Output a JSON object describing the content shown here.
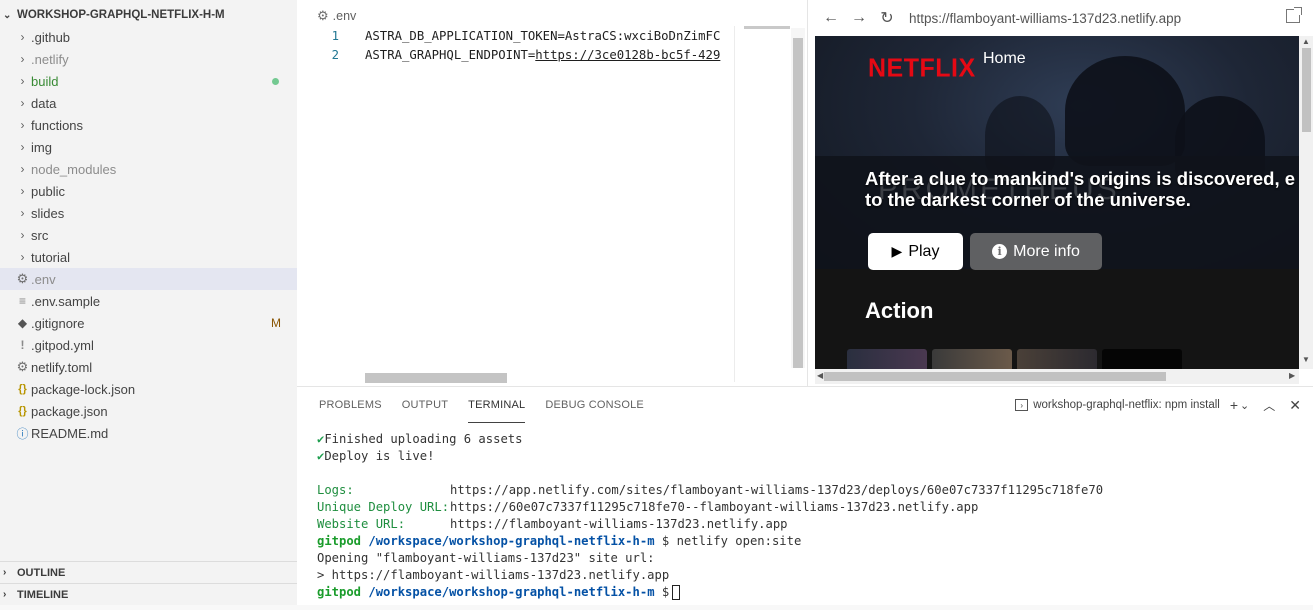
{
  "explorer": {
    "title": "WORKSHOP-GRAPHQL-NETFLIX-H-M",
    "items": [
      {
        "label": ".github",
        "kind": "folder"
      },
      {
        "label": ".netlify",
        "kind": "folder"
      },
      {
        "label": "build",
        "kind": "folder"
      },
      {
        "label": "data",
        "kind": "folder"
      },
      {
        "label": "functions",
        "kind": "folder"
      },
      {
        "label": "img",
        "kind": "folder"
      },
      {
        "label": "node_modules",
        "kind": "folder"
      },
      {
        "label": "public",
        "kind": "folder"
      },
      {
        "label": "slides",
        "kind": "folder"
      },
      {
        "label": "src",
        "kind": "folder"
      },
      {
        "label": "tutorial",
        "kind": "folder"
      },
      {
        "label": ".env",
        "kind": "file"
      },
      {
        "label": ".env.sample",
        "kind": "file"
      },
      {
        "label": ".gitignore",
        "kind": "file",
        "badge": "M"
      },
      {
        "label": ".gitpod.yml",
        "kind": "file"
      },
      {
        "label": "netlify.toml",
        "kind": "file"
      },
      {
        "label": "package-lock.json",
        "kind": "file"
      },
      {
        "label": "package.json",
        "kind": "file"
      },
      {
        "label": "README.md",
        "kind": "file"
      }
    ],
    "outline_label": "OUTLINE",
    "timeline_label": "TIMELINE"
  },
  "editor": {
    "tab_label": ".env",
    "lines": [
      {
        "num": "1",
        "prefix": "ASTRA_DB_APPLICATION_TOKEN=AstraCS:wxciBoDnZimFC",
        "url": ""
      },
      {
        "num": "2",
        "prefix": "ASTRA_GRAPHQL_ENDPOINT=",
        "url": "https://3ce0128b-bc5f-429"
      }
    ]
  },
  "browser": {
    "url": "https://flamboyant-williams-137d23.netlify.app",
    "logo": "NETFLIX",
    "nav_home": "Home",
    "ghost_title": "PROMETHEUS",
    "hero_line1": "After a clue to mankind's origins is discovered, e",
    "hero_line2": "to the darkest corner of the universe.",
    "play_label": "Play",
    "more_label": "More info",
    "row_title": "Action",
    "colors": {
      "logo": "#e50914",
      "background": "#141414"
    }
  },
  "panel": {
    "tabs": [
      "PROBLEMS",
      "OUTPUT",
      "TERMINAL",
      "DEBUG CONSOLE"
    ],
    "active_tab": "TERMINAL",
    "terminal_name": "workshop-graphql-netflix: npm install",
    "lines": {
      "l1": "Finished uploading 6 assets",
      "l2": "Deploy is live!",
      "logs_key": "Logs:",
      "logs_val": "https://app.netlify.com/sites/flamboyant-williams-137d23/deploys/60e07c7337f11295c718fe70",
      "unique_key": "Unique Deploy URL:",
      "unique_val": "https://60e07c7337f11295c718fe70--flamboyant-williams-137d23.netlify.app",
      "website_key": "Website URL:",
      "website_val": "https://flamboyant-williams-137d23.netlify.app",
      "prompt_user": "gitpod",
      "prompt_path": "/workspace/workshop-graphql-netflix-h-m",
      "cmd": "$ netlify open:site",
      "opening": "Opening \"flamboyant-williams-137d23\" site url:",
      "opened": "> https://flamboyant-williams-137d23.netlify.app",
      "prompt_end": "$"
    }
  }
}
